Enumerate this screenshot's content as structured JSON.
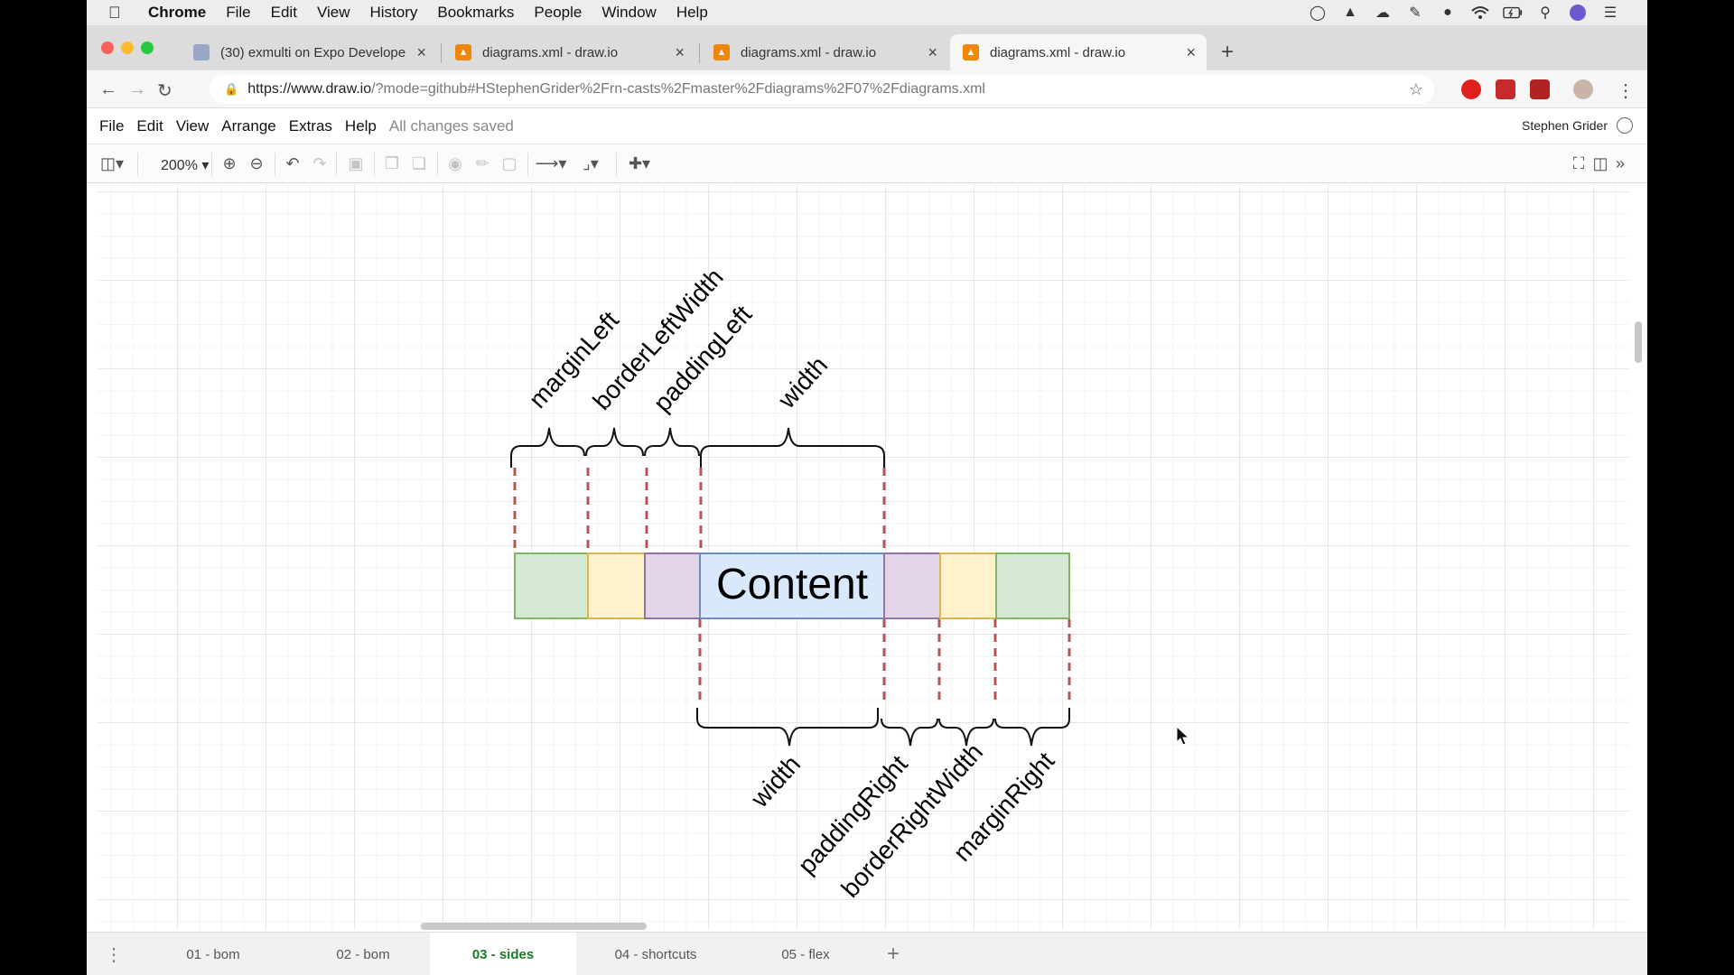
{
  "menubar": {
    "app": "Chrome",
    "items": [
      "File",
      "Edit",
      "View",
      "History",
      "Bookmarks",
      "People",
      "Window",
      "Help"
    ],
    "status_icons": [
      "glasses-icon",
      "elephant-icon",
      "cloud-icon",
      "pen-icon",
      "camera-icon",
      "wifi-icon",
      "battery-icon",
      "search-icon",
      "siri-icon",
      "list-icon"
    ]
  },
  "browser": {
    "tabs": [
      {
        "title": "(30) exmulti on Expo Develope",
        "favicon": "expo-icon",
        "active": false
      },
      {
        "title": "diagrams.xml - draw.io",
        "favicon": "drawio-icon",
        "active": false
      },
      {
        "title": "diagrams.xml - draw.io",
        "favicon": "drawio-icon",
        "active": false
      },
      {
        "title": "diagrams.xml - draw.io",
        "favicon": "drawio-icon",
        "active": true
      }
    ],
    "url_host": "https://www.draw.io",
    "url_rest": "/?mode=github#HStephenGrider%2Frn-casts%2Fmaster%2Fdiagrams%2F07%2Fdiagrams.xml"
  },
  "app": {
    "menu": [
      "File",
      "Edit",
      "View",
      "Arrange",
      "Extras",
      "Help"
    ],
    "saved_status": "All changes saved",
    "user": "Stephen Grider",
    "zoom": "200%"
  },
  "diagram": {
    "content_label": "Content",
    "top_labels": [
      "marginLeft",
      "borderLeftWidth",
      "paddingLeft",
      "width"
    ],
    "bottom_labels": [
      "width",
      "paddingRight",
      "borderRightWidth",
      "marginRight"
    ],
    "colors": {
      "margin_fill": "#d5e8d4",
      "margin_stroke": "#82b366",
      "border_fill": "#fff2cc",
      "border_stroke": "#d6b656",
      "padding_fill": "#e1d5e7",
      "padding_stroke": "#9673a6",
      "content_fill": "#dae8fc",
      "content_stroke": "#6c8ebf",
      "dash": "#b85450"
    }
  },
  "pages": {
    "tabs": [
      "01 - bom",
      "02 - bom",
      "03 - sides",
      "04 - shortcuts",
      "05 - flex"
    ],
    "active": "03 - sides"
  }
}
